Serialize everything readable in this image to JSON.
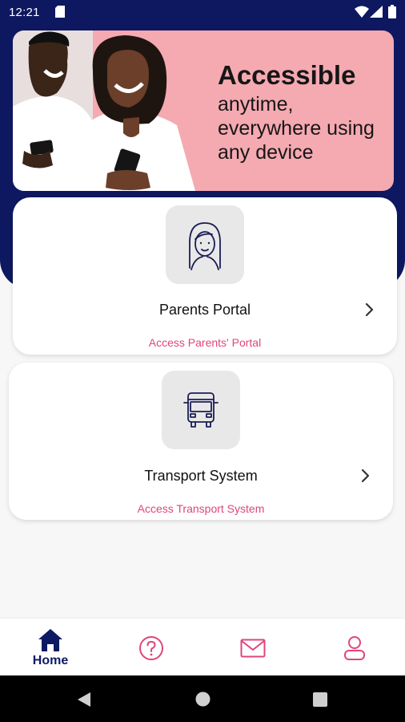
{
  "status_bar": {
    "time": "12:21"
  },
  "hero": {
    "title": "Accessible",
    "subtitle": "anytime, everywhere using any device"
  },
  "cards": [
    {
      "title": "Parents Portal",
      "subtitle": "Access Parents' Portal",
      "icon": "girl-avatar-icon"
    },
    {
      "title": "Transport System",
      "subtitle": "Access Transport System",
      "icon": "bus-icon"
    }
  ],
  "bottom_nav": {
    "items": [
      {
        "label": "Home",
        "icon": "home-icon",
        "active": true
      },
      {
        "label": "",
        "icon": "help-icon",
        "active": false
      },
      {
        "label": "",
        "icon": "mail-icon",
        "active": false
      },
      {
        "label": "",
        "icon": "profile-icon",
        "active": false
      }
    ]
  },
  "colors": {
    "primary": "#0d1860",
    "accent": "#e0457d",
    "hero_bg": "#f5a9b1"
  }
}
